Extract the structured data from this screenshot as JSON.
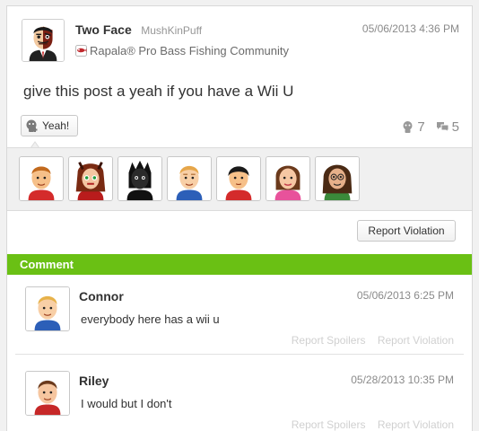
{
  "post": {
    "author_name": "Two Face",
    "author_id": "MushKinPuff",
    "community": "Rapala® Pro Bass Fishing Community",
    "timestamp": "05/06/2013 4:36 PM",
    "body": "give this post a yeah if you have a Wii U",
    "yeah_label": "Yeah!",
    "yeah_count": "7",
    "comment_count": "5",
    "report_label": "Report Violation"
  },
  "comments_header": "Comment",
  "comments": [
    {
      "name": "Connor",
      "timestamp": "05/06/2013 6:25 PM",
      "text": "everybody here has a wii u",
      "report_spoilers": "Report Spoilers",
      "report_violation": "Report Violation"
    },
    {
      "name": "Riley",
      "timestamp": "05/28/2013 10:35 PM",
      "text": "I would but I don't",
      "report_spoilers": "Report Spoilers",
      "report_violation": "Report Violation"
    }
  ],
  "icons": {
    "community": "rapala-community-icon",
    "yeah": "yeah-icon",
    "empathy": "empathy-icon",
    "comments": "comment-bubbles-icon"
  },
  "colors": {
    "accent_green": "#6ac014",
    "muted_text": "#8a8a8a",
    "faded_action_text": "#d0d0d0"
  }
}
